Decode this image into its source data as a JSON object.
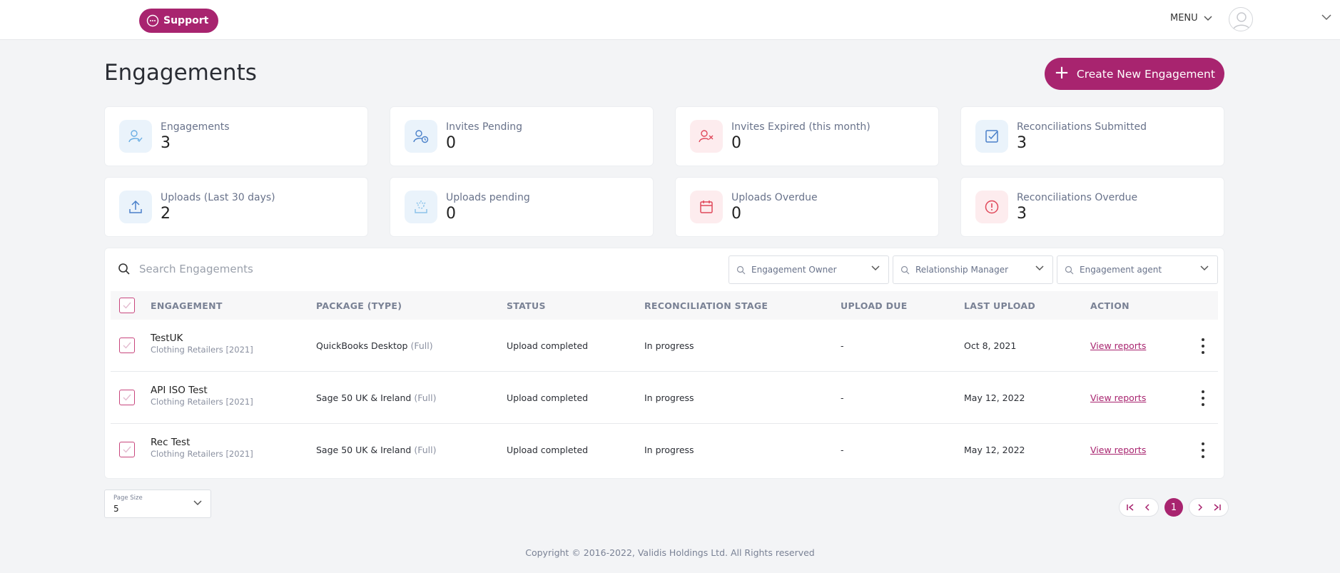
{
  "header": {
    "support_label": "Support",
    "menu_label": "MENU"
  },
  "page": {
    "title": "Engagements",
    "create_label": "Create New Engagement"
  },
  "stats": [
    {
      "label": "Engagements",
      "value": "3",
      "icon": "user-check-icon"
    },
    {
      "label": "Invites Pending",
      "value": "0",
      "icon": "user-clock-icon"
    },
    {
      "label": "Invites Expired (this month)",
      "value": "0",
      "icon": "user-x-icon"
    },
    {
      "label": "Reconciliations Submitted",
      "value": "3",
      "icon": "checkbox-icon"
    },
    {
      "label": "Uploads (Last 30 days)",
      "value": "2",
      "icon": "upload-icon"
    },
    {
      "label": "Uploads pending",
      "value": "0",
      "icon": "upload-pending-icon"
    },
    {
      "label": "Uploads Overdue",
      "value": "0",
      "icon": "calendar-icon"
    },
    {
      "label": "Reconciliations Overdue",
      "value": "3",
      "icon": "alert-circle-icon"
    }
  ],
  "table": {
    "search_placeholder": "Search Engagements",
    "filters": [
      "Engagement Owner",
      "Relationship Manager",
      "Engagement agent"
    ],
    "columns": [
      "ENGAGEMENT",
      "PACKAGE (TYPE)",
      "STATUS",
      "RECONCILIATION STAGE",
      "UPLOAD DUE",
      "LAST UPLOAD",
      "ACTION"
    ],
    "rows": [
      {
        "name": "TestUK",
        "sub": "Clothing Retailers [2021]",
        "package": "QuickBooks Desktop",
        "type": "(Full)",
        "status": "Upload completed",
        "stage": "In progress",
        "due": "-",
        "last": "Oct 8, 2021",
        "action": "View reports"
      },
      {
        "name": "API ISO Test",
        "sub": "Clothing Retailers [2021]",
        "package": "Sage 50 UK & Ireland",
        "type": "(Full)",
        "status": "Upload completed",
        "stage": "In progress",
        "due": "-",
        "last": "May 12, 2022",
        "action": "View reports"
      },
      {
        "name": "Rec Test",
        "sub": "Clothing Retailers [2021]",
        "package": "Sage 50 UK & Ireland",
        "type": "(Full)",
        "status": "Upload completed",
        "stage": "In progress",
        "due": "-",
        "last": "May 12, 2022",
        "action": "View reports"
      }
    ]
  },
  "pagination": {
    "page_size_label": "Page Size",
    "page_size": "5",
    "current_page": "1"
  },
  "footer": {
    "copyright": "Copyright © 2016-2022, Validis Holdings Ltd. All Rights reserved"
  },
  "colors": {
    "accent": "#a8246f",
    "icon_blue": "#4a90d9",
    "icon_red": "#e0485a"
  }
}
